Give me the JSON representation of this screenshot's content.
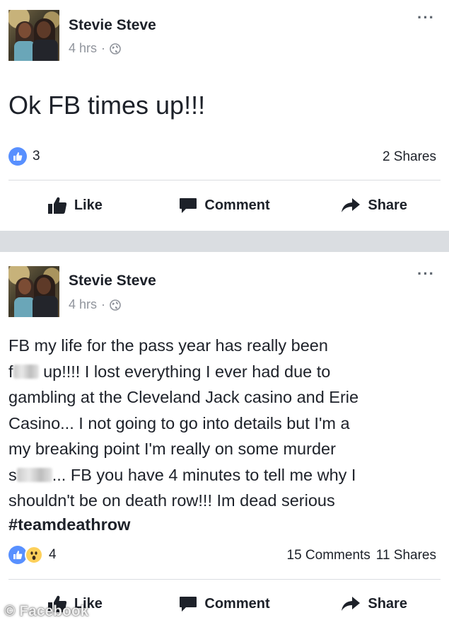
{
  "posts": [
    {
      "author": "Stevie Steve",
      "time": "4 hrs",
      "privacy_icon": "globe-icon",
      "text": "Ok FB times up!!!",
      "reaction_count": "3",
      "stats": {
        "comments": "",
        "shares": "2 Shares"
      },
      "actions": {
        "like": "Like",
        "comment": "Comment",
        "share": "Share"
      }
    },
    {
      "author": "Stevie Steve",
      "time": "4 hrs",
      "privacy_icon": "globe-icon",
      "lines": [
        "FB my life for the pass year has really been",
        "up!!!! I lost everything I ever had due to",
        "gambling at the Cleveland Jack casino and Erie",
        "Casino... I not going to go into details but I'm a",
        "my breaking point I'm really on some murder",
        "... FB you have 4 minutes to tell me why I",
        "shouldn't be on death row!!! Im dead serious"
      ],
      "censored_prefix_line2": "f",
      "censored_prefix_line6": "s",
      "hashtag": "#teamdeathrow",
      "reaction_count": "4",
      "stats": {
        "comments": "15 Comments",
        "shares": "11 Shares"
      },
      "actions": {
        "like": "Like",
        "comment": "Comment",
        "share": "Share"
      }
    }
  ],
  "watermark": "© Facebook",
  "colors": {
    "like_blue": "#5890ff",
    "wow_yellow": "#fdd05a",
    "separator": "#dadde1",
    "meta_gray": "#90949c"
  }
}
